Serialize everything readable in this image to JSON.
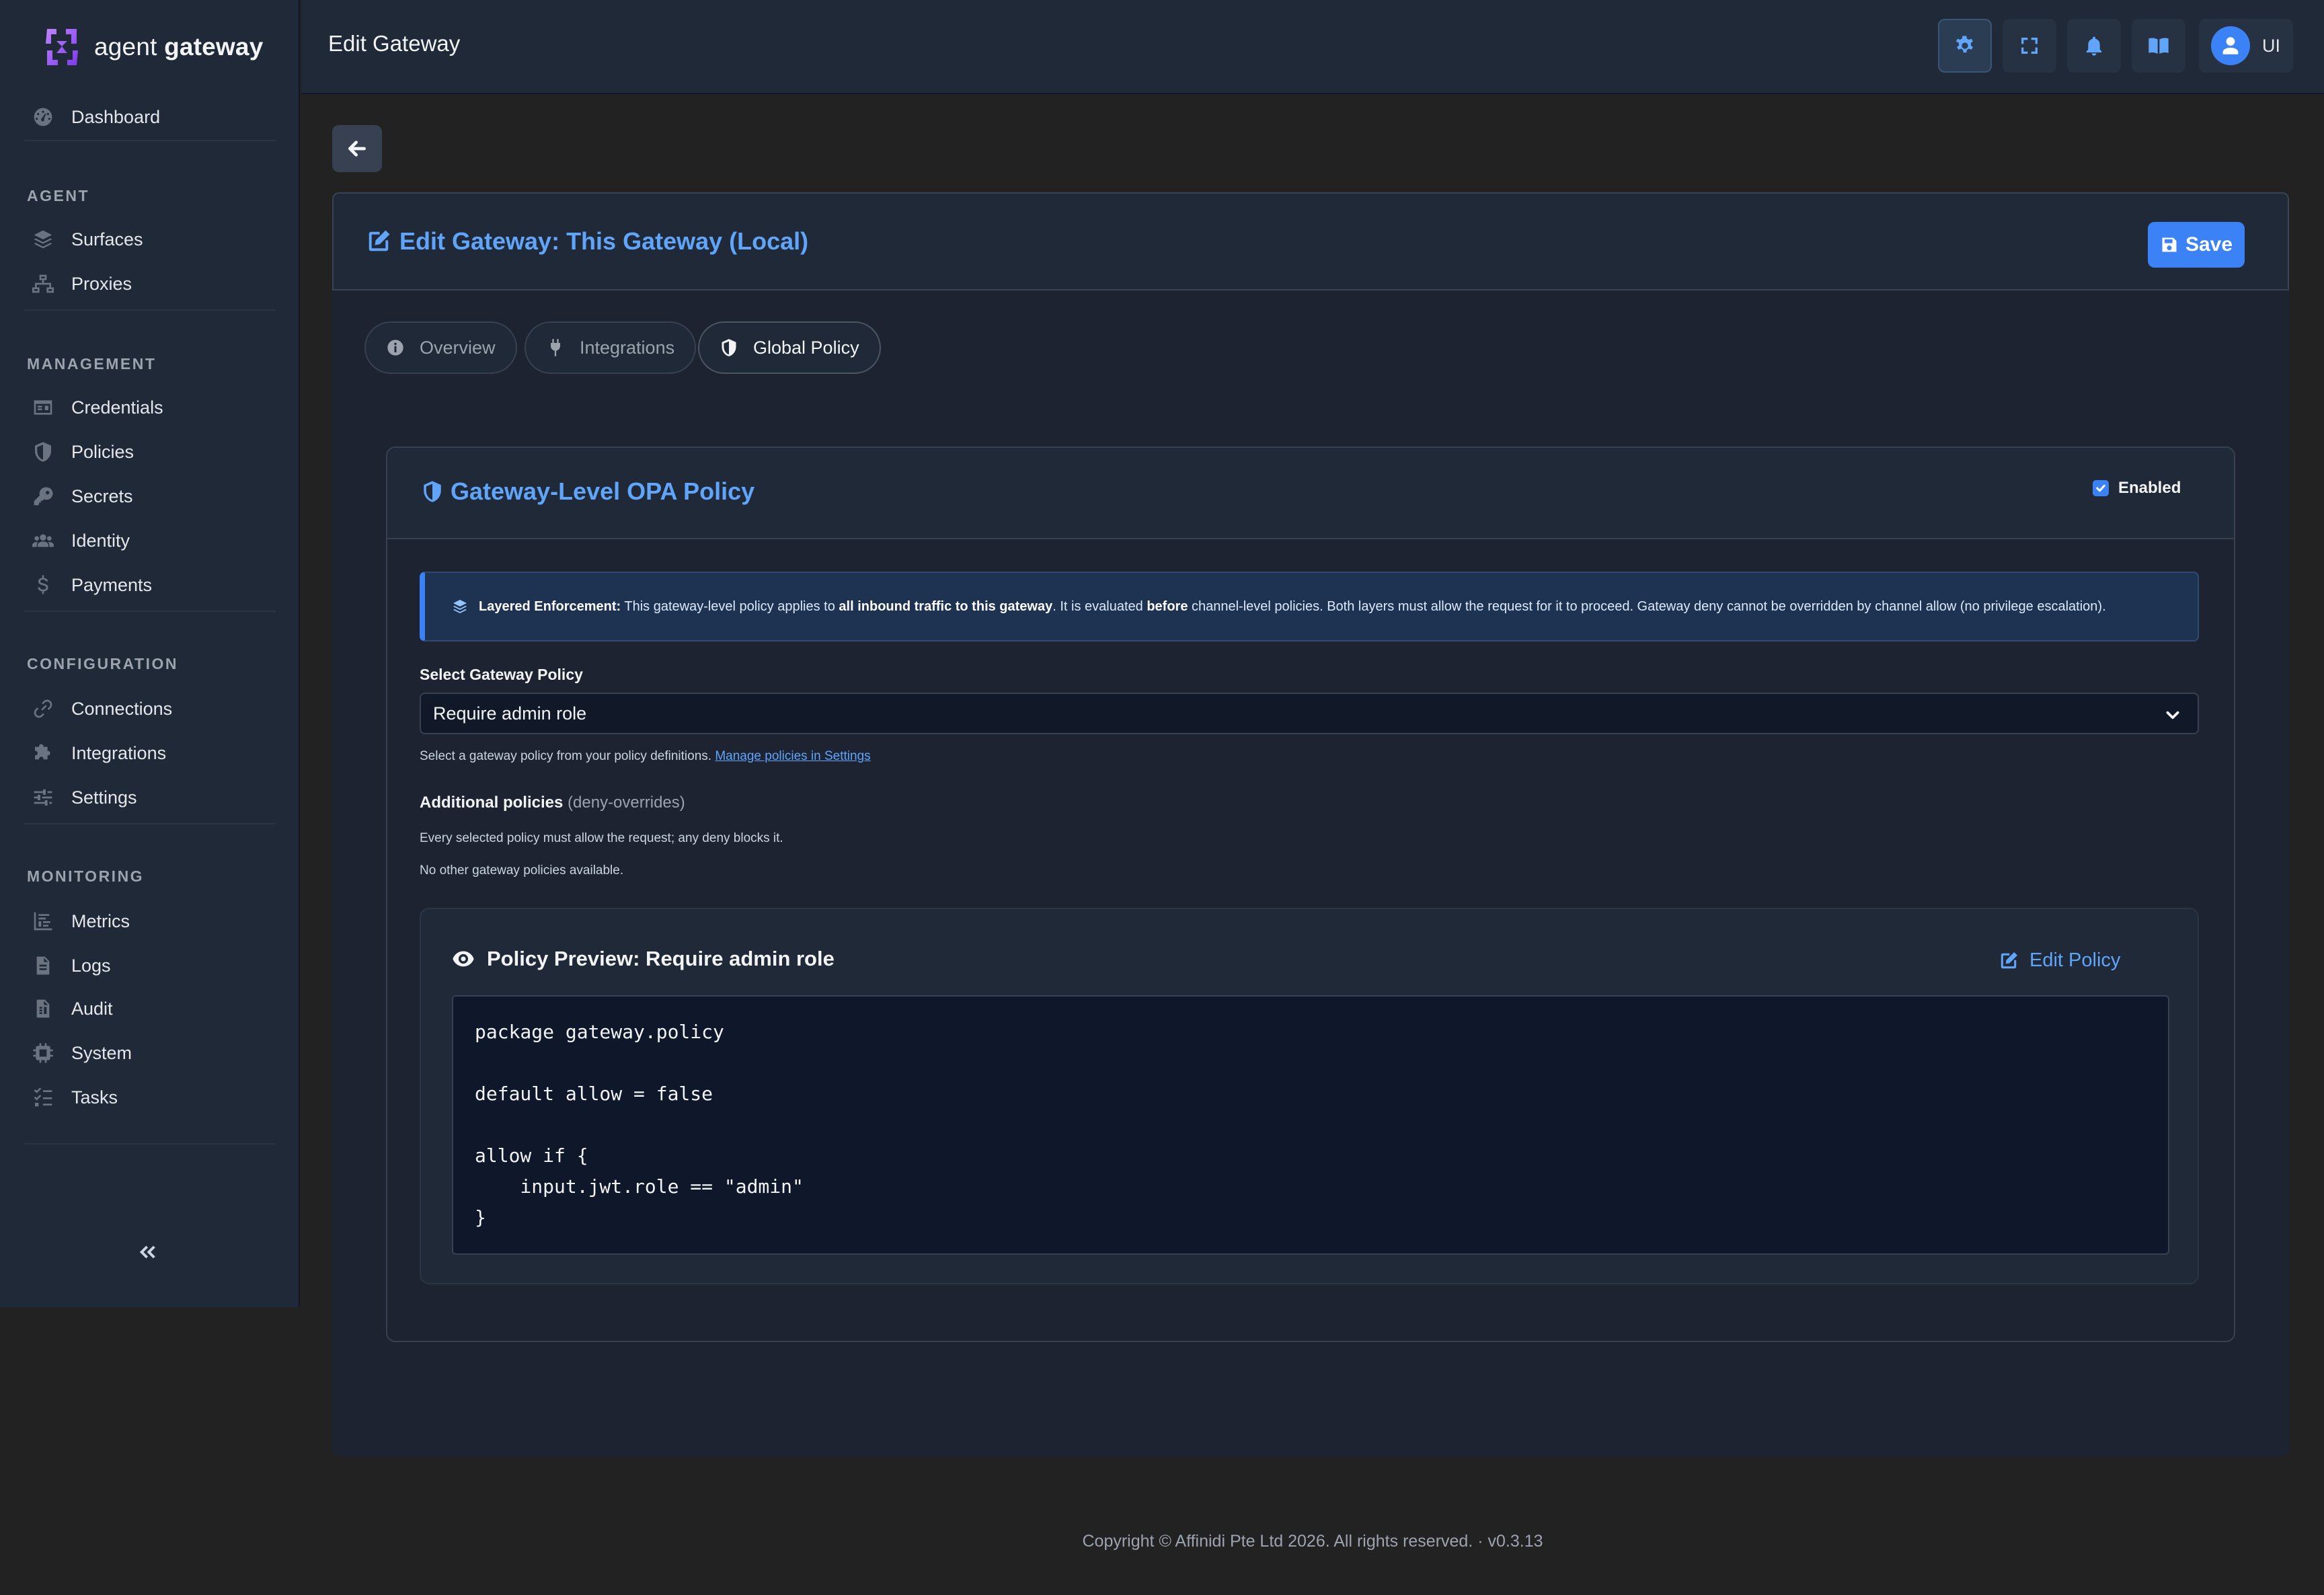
{
  "brand": {
    "light": "agent",
    "bold": "gateway"
  },
  "sidebar": {
    "dashboard": {
      "label": "Dashboard",
      "icon": "dashboard-gauge-icon"
    },
    "sections": [
      {
        "title": "AGENT",
        "items": [
          {
            "label": "Surfaces",
            "icon": "layers-icon"
          },
          {
            "label": "Proxies",
            "icon": "network-icon"
          }
        ]
      },
      {
        "title": "MANAGEMENT",
        "items": [
          {
            "label": "Credentials",
            "icon": "id-card-icon"
          },
          {
            "label": "Policies",
            "icon": "shield-icon"
          },
          {
            "label": "Secrets",
            "icon": "key-icon"
          },
          {
            "label": "Identity",
            "icon": "users-icon"
          },
          {
            "label": "Payments",
            "icon": "dollar-icon"
          }
        ]
      },
      {
        "title": "CONFIGURATION",
        "items": [
          {
            "label": "Connections",
            "icon": "link-icon"
          },
          {
            "label": "Integrations",
            "icon": "puzzle-icon"
          },
          {
            "label": "Settings",
            "icon": "sliders-icon"
          }
        ]
      },
      {
        "title": "MONITORING",
        "items": [
          {
            "label": "Metrics",
            "icon": "chart-icon"
          },
          {
            "label": "Logs",
            "icon": "file-icon"
          },
          {
            "label": "Audit",
            "icon": "audit-file-icon"
          },
          {
            "label": "System",
            "icon": "chip-icon"
          },
          {
            "label": "Tasks",
            "icon": "list-check-icon"
          }
        ]
      }
    ],
    "collapse_icon": "double-chevron-left-icon"
  },
  "topbar": {
    "title": "Edit Gateway",
    "buttons": [
      "gear-icon",
      "fullscreen-icon",
      "bell-icon",
      "book-icon"
    ],
    "user_label": "UI"
  },
  "card": {
    "title": "Edit Gateway: This Gateway (Local)",
    "save_label": "Save",
    "tabs": [
      {
        "label": "Overview",
        "icon": "info-circle-icon"
      },
      {
        "label": "Integrations",
        "icon": "plug-icon"
      },
      {
        "label": "Global Policy",
        "icon": "shield-half-icon"
      }
    ]
  },
  "policy": {
    "title": "Gateway-Level OPA Policy",
    "enabled_label": "Enabled",
    "enabled": true,
    "alert": {
      "heading": "Layered Enforcement:",
      "text1": " This gateway-level policy applies to ",
      "bold1": "all inbound traffic to this gateway",
      "text2": ". It is evaluated ",
      "bold2": "before",
      "text3": " channel-level policies. Both layers must allow the request for it to proceed. Gateway deny cannot be overridden by channel allow (no privilege escalation)."
    },
    "select_label": "Select Gateway Policy",
    "select_value": "Require admin role",
    "help_text": "Select a gateway policy from your policy definitions. ",
    "help_link": "Manage policies in Settings",
    "additional_label": "Additional policies",
    "additional_suffix": " (deny-overrides)",
    "additional_desc": "Every selected policy must allow the request; any deny blocks it.",
    "no_other": "No other gateway policies available."
  },
  "preview": {
    "title": "Policy Preview: Require admin role",
    "edit_label": "Edit Policy",
    "code": "package gateway.policy\n\ndefault allow = false\n\nallow if {\n    input.jwt.role == \"admin\"\n}"
  },
  "footer": "Copyright © Affinidi Pte Ltd 2026. All rights reserved. · v0.3.13",
  "colors": {
    "accent": "#3b82f6",
    "link": "#60a5fa",
    "brand_purple": "#a855f7"
  }
}
